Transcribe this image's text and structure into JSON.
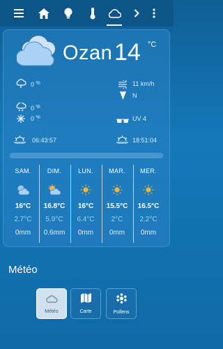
{
  "nav": {
    "items": [
      {
        "icon": "menu-icon"
      },
      {
        "icon": "home-icon"
      },
      {
        "icon": "bulb-icon"
      },
      {
        "icon": "thermometer-icon"
      },
      {
        "icon": "cloud-icon",
        "active": true
      },
      {
        "icon": "chevron-right-icon"
      },
      {
        "icon": "more-vert-icon"
      }
    ]
  },
  "weather": {
    "city": "Ozan",
    "temperature": "14",
    "unit": "°C",
    "rain_probability": "0",
    "rain_unit": "%",
    "snow_probability": "0",
    "frost_probability": "0",
    "wind_speed": "11",
    "wind_unit": "km/h",
    "wind_direction": "N",
    "uv": "UV 4",
    "sunrise": "06:43:57",
    "sunset": "18:51:04"
  },
  "forecast": [
    {
      "day": "SAM.",
      "icon": "partly-cloudy-night-icon",
      "max": "16°C",
      "min": "2.7°C",
      "rain": "0mm"
    },
    {
      "day": "DIM.",
      "icon": "partly-cloudy-day-icon",
      "max": "16.8°C",
      "min": "5.9°C",
      "rain": "0.6mm"
    },
    {
      "day": "LUN.",
      "icon": "sunny-icon",
      "max": "16°C",
      "min": "6.4°C",
      "rain": "0mm"
    },
    {
      "day": "MAR.",
      "icon": "sunny-icon",
      "max": "15.5°C",
      "min": "2°C",
      "rain": "0mm"
    },
    {
      "day": "MER.",
      "icon": "sunny-icon",
      "max": "16.5°C",
      "min": "2.2°C",
      "rain": "0mm"
    }
  ],
  "section": {
    "title": "Météo",
    "tabs": [
      {
        "label": "Météo",
        "icon": "cloud-outline-icon",
        "active": true
      },
      {
        "label": "Carte",
        "icon": "map-icon",
        "active": false
      },
      {
        "label": "Pollens",
        "icon": "pollen-icon",
        "active": false
      }
    ]
  },
  "colors": {
    "background": "#1578b8",
    "topbar": "#0d5588",
    "sun": "#f4b63a",
    "min_temp": "#9fd3f5"
  }
}
